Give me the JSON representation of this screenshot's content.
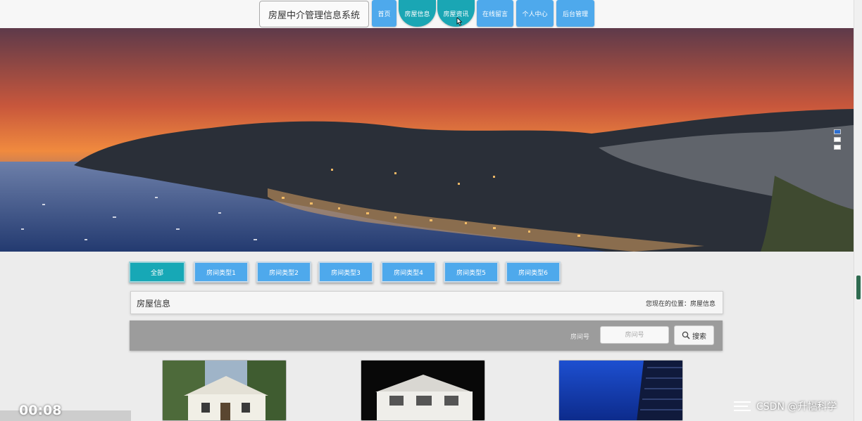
{
  "header": {
    "brand": "房屋中介管理信息系统",
    "nav": [
      {
        "label": "首页"
      },
      {
        "label": "房屋信息",
        "active": true
      },
      {
        "label": "房屋资讯",
        "active": true
      },
      {
        "label": "在线留言"
      },
      {
        "label": "个人中心"
      },
      {
        "label": "后台管理"
      }
    ]
  },
  "banner": {
    "slides": 3,
    "active_slide": 1
  },
  "categories": [
    "全部",
    "房间类型1",
    "房间类型2",
    "房间类型3",
    "房间类型4",
    "房间类型5",
    "房间类型6"
  ],
  "active_category": "全部",
  "section": {
    "title": "房屋信息",
    "breadcrumb_prefix": "您现在的位置：",
    "breadcrumb_current": "房屋信息"
  },
  "search": {
    "label": "房间号",
    "placeholder": "房间号",
    "button": "搜索"
  },
  "listings": [
    {
      "image": "white-villa-photo"
    },
    {
      "image": "house-model-photo"
    },
    {
      "image": "blue-glass-building-photo"
    }
  ],
  "overlay": {
    "timer": "00:08",
    "watermark": "CSDN @升幅科学"
  },
  "colors": {
    "nav_blue": "#4ea9ec",
    "active_teal": "#17a8b6",
    "search_bar_gray": "#9c9c9c"
  }
}
